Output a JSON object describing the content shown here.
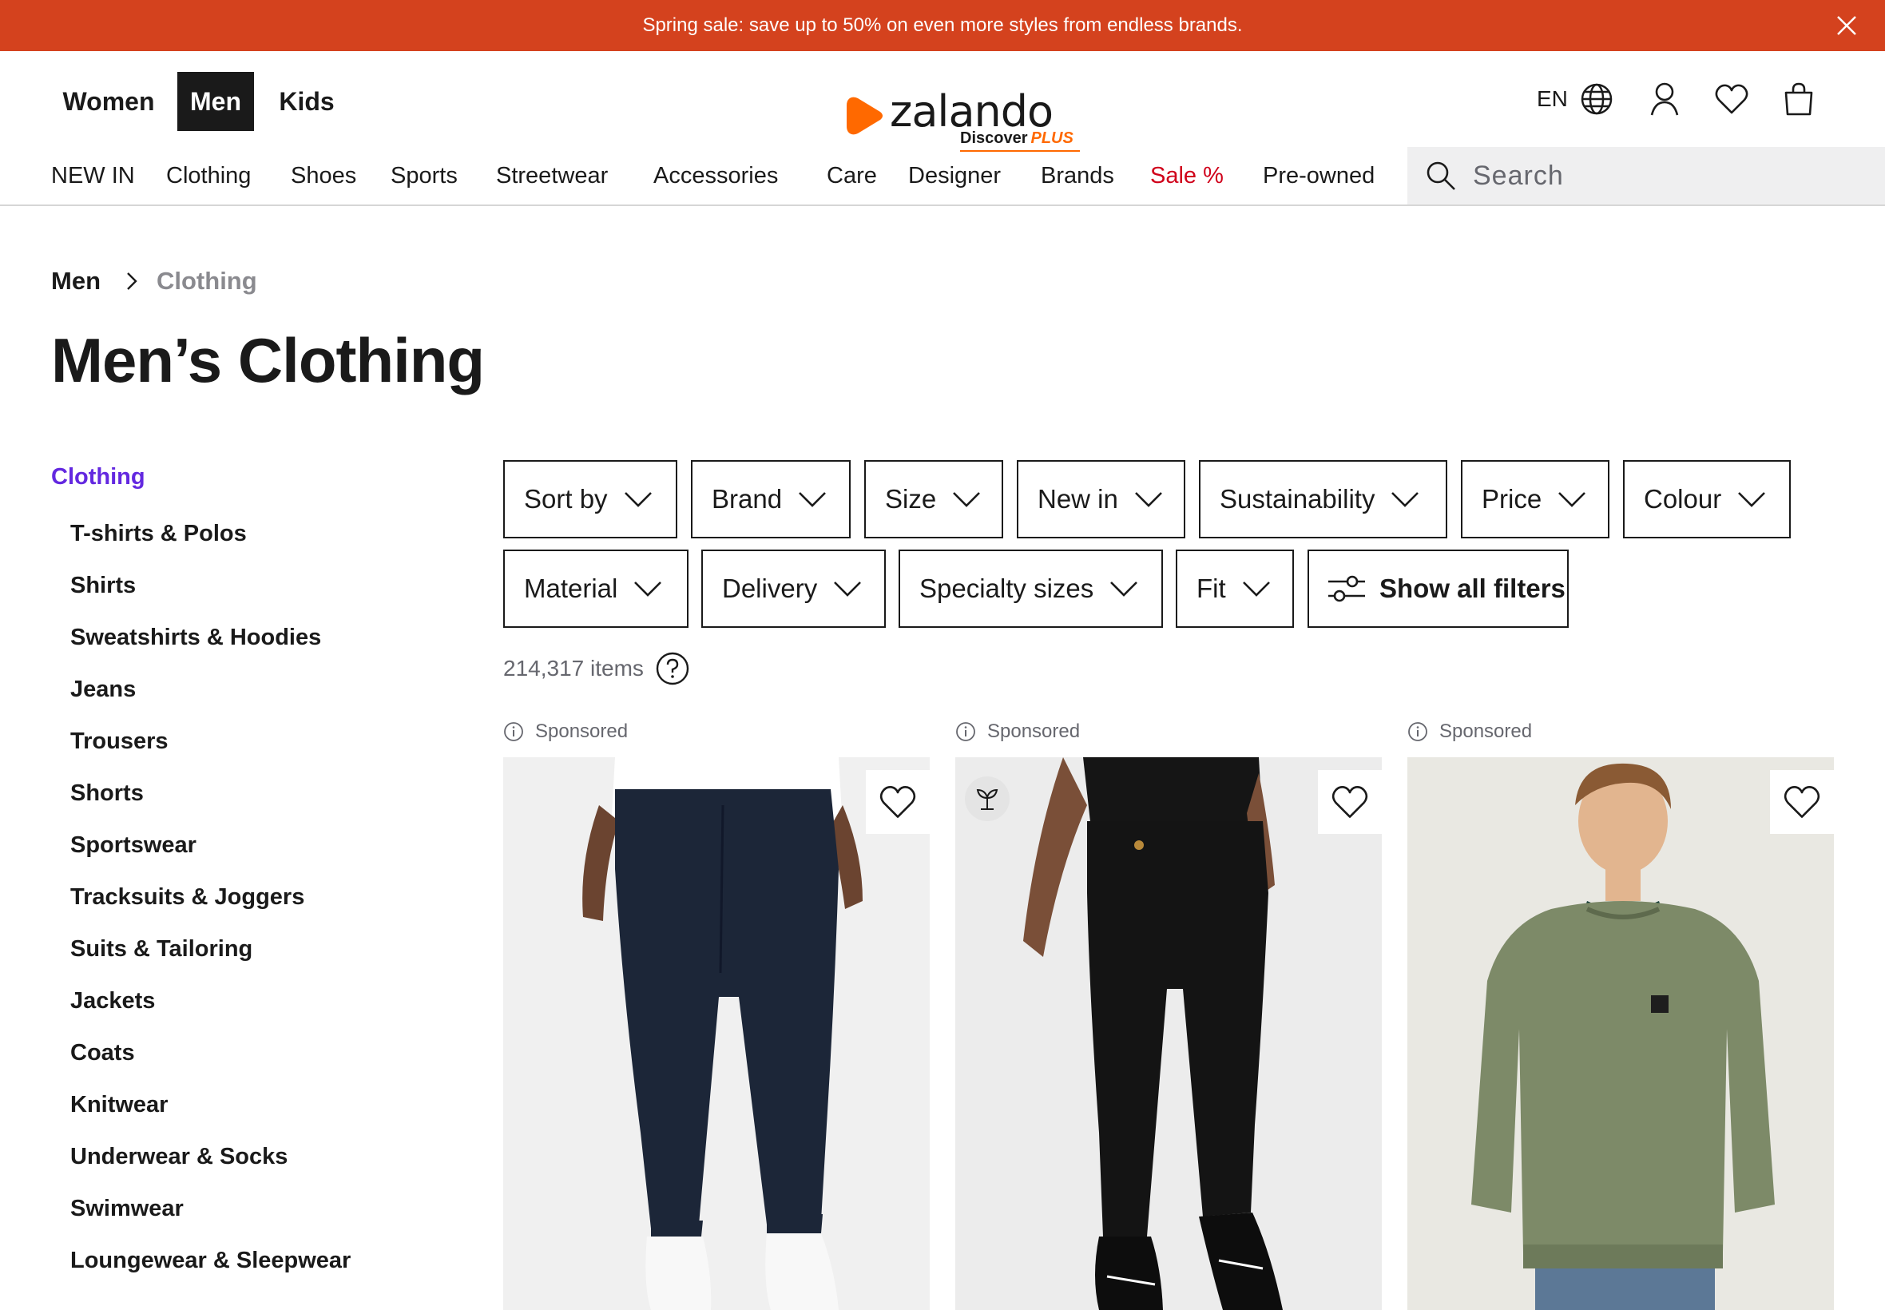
{
  "banner": {
    "text": "Spring sale: save up to 50% on even more styles from endless brands."
  },
  "header": {
    "gender_tabs": [
      {
        "label": "Women",
        "active": false
      },
      {
        "label": "Men",
        "active": true
      },
      {
        "label": "Kids",
        "active": false
      }
    ],
    "logo": {
      "word": "zalando",
      "sub": "Discover",
      "sub_plus": "PLUS"
    },
    "language": "EN"
  },
  "nav": {
    "items": [
      "NEW IN",
      "Clothing",
      "Shoes",
      "Sports",
      "Streetwear",
      "Accessories",
      "Care",
      "Designer",
      "Brands",
      "Sale %",
      "Pre-owned"
    ],
    "search_placeholder": "Search"
  },
  "breadcrumb": {
    "parent": "Men",
    "current": "Clothing"
  },
  "page_title": "Men’s Clothing",
  "sidebar": {
    "heading": "Clothing",
    "items": [
      "T-shirts & Polos",
      "Shirts",
      "Sweatshirts & Hoodies",
      "Jeans",
      "Trousers",
      "Shorts",
      "Sportswear",
      "Tracksuits & Joggers",
      "Suits & Tailoring",
      "Jackets",
      "Coats",
      "Knitwear",
      "Underwear & Socks",
      "Swimwear",
      "Loungewear & Sleepwear"
    ]
  },
  "filters": {
    "row1": [
      "Sort by",
      "Brand",
      "Size",
      "New in",
      "Sustainability",
      "Price",
      "Colour"
    ],
    "row2": [
      "Material",
      "Delivery",
      "Specialty sizes",
      "Fit"
    ],
    "show_all": "Show all filters"
  },
  "results": {
    "count": "214,317 items"
  },
  "products": [
    {
      "sponsored": "Sponsored",
      "image": "navy chino trousers",
      "eco": false
    },
    {
      "sponsored": "Sponsored",
      "image": "black chino trousers",
      "eco": true
    },
    {
      "sponsored": "Sponsored",
      "image": "olive green crew sweatshirt",
      "eco": false
    }
  ],
  "colors": {
    "banner": "#d4421e",
    "brand_orange": "#ff6900",
    "sidebar_active": "#6328e0",
    "sale": "#d0021b"
  }
}
